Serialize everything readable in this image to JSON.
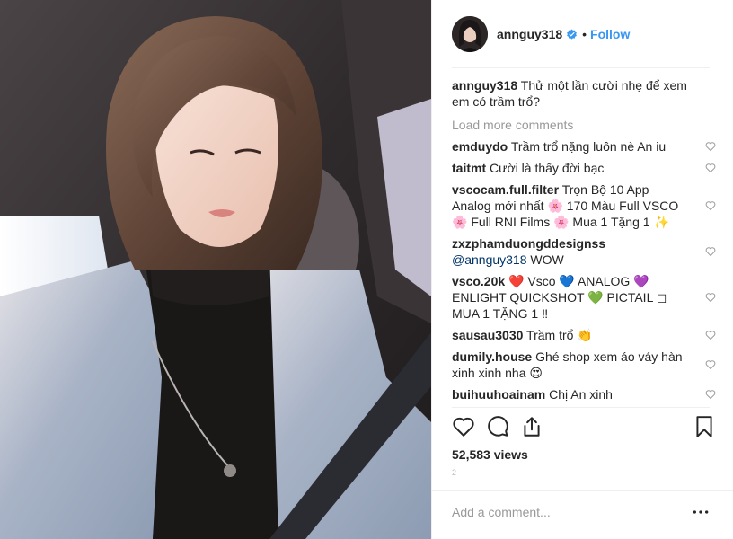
{
  "post": {
    "author": "annguy318",
    "follow_label": "Follow",
    "dot": "•",
    "caption": "Thử một lần cười nhẹ để xem em có trầm trổ?",
    "load_more": "Load more comments",
    "comments": [
      {
        "user": "emduydo",
        "text": "Trầm trổ nặng luôn nè An iu"
      },
      {
        "user": "taitmt",
        "text": "Cười là thấy đời bạc"
      },
      {
        "user": "vscocam.full.filter",
        "text": "Trọn Bộ 10 App Analog mới nhất 🌸 170 Màu Full VSCO 🌸 Full RNI Films 🌸 Mua 1 Tặng 1 ✨"
      },
      {
        "user": "zxzphamduongddesignss",
        "mention": "@annguy318",
        "text": "WOW"
      },
      {
        "user": "vsco.20k",
        "text": "❤️ Vsco 💙 ANALOG 💜 ENLIGHT QUICKSHOT 💚 PICTAIL ◻ MUA 1 TẶNG 1 ‼"
      },
      {
        "user": "sausau3030",
        "text": "Trầm trổ 👏"
      },
      {
        "user": "dumily.house",
        "text": "Ghé shop xem áo váy hàn xinh xinh nha 😍"
      },
      {
        "user": "buihuuhoainam",
        "text": "Chị An xinh"
      }
    ],
    "views": "52,583 views",
    "small_mark": "2",
    "add_comment_placeholder": "Add a comment...",
    "more_glyph": "•••"
  },
  "icons": {
    "verified": "verified-badge-icon",
    "heart": "heart-icon",
    "comment": "comment-icon",
    "share": "share-icon",
    "bookmark": "bookmark-icon",
    "more": "more-options-icon"
  },
  "colors": {
    "accent": "#3897f0",
    "text": "#262626",
    "muted": "#999999",
    "divider": "#efefef"
  }
}
